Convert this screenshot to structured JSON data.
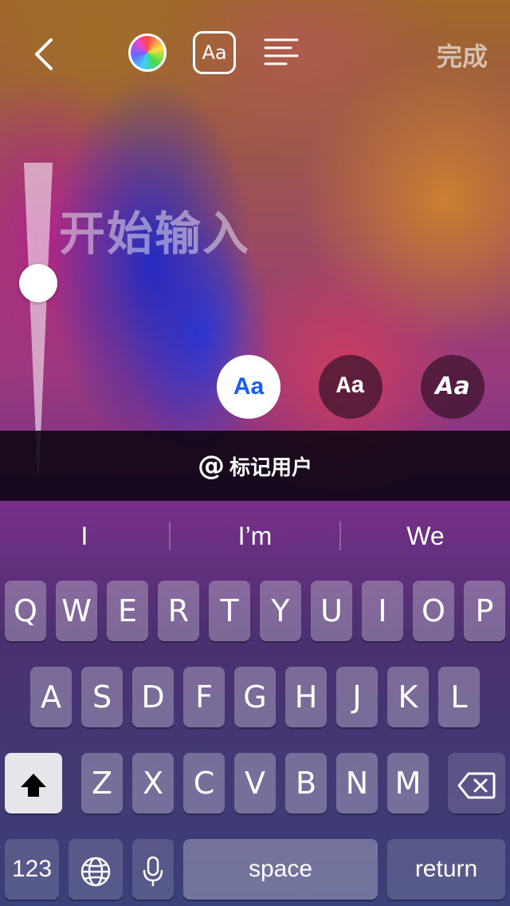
{
  "toolbar": {
    "back_icon": "chevron-left-icon",
    "color_icon": "color-wheel-icon",
    "font_label": "Aa",
    "align_icon": "text-align-left-icon",
    "done_label": "完成"
  },
  "editor": {
    "placeholder": "开始输入",
    "text_size": 0.35
  },
  "styles": [
    {
      "label": "Aa",
      "selected": true
    },
    {
      "label": "Aa",
      "selected": false
    },
    {
      "label": "Aa",
      "selected": false
    }
  ],
  "mention": {
    "at_symbol": "@",
    "label": "标记用户"
  },
  "keyboard": {
    "suggestions": [
      "I",
      "I’m",
      "We"
    ],
    "row1": [
      "Q",
      "W",
      "E",
      "R",
      "T",
      "Y",
      "U",
      "I",
      "O",
      "P"
    ],
    "row2": [
      "A",
      "S",
      "D",
      "F",
      "G",
      "H",
      "J",
      "K",
      "L"
    ],
    "row3": [
      "Z",
      "X",
      "C",
      "V",
      "B",
      "N",
      "M"
    ],
    "numbers_label": "123",
    "space_label": "space",
    "return_label": "return",
    "shift_icon": "shift-icon",
    "delete_icon": "backspace-icon",
    "globe_icon": "globe-icon",
    "mic_icon": "microphone-icon"
  }
}
